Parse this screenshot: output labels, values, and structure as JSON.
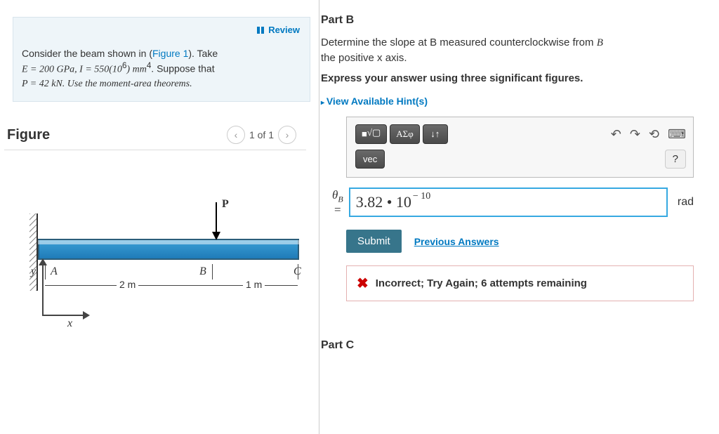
{
  "left": {
    "review_label": "Review",
    "problem_html_prefix": "Consider the beam shown in (",
    "figure_link": "Figure 1",
    "problem_html_suffix": "). Take",
    "problem_line2a": "E = 200 GPa, I = 550(10",
    "problem_line2b": ") mm",
    "problem_line2c": ".  Suppose that",
    "problem_line3": "P = 42 kN.  Use the moment-area theorems.",
    "exp6": "6",
    "exp4": "4",
    "figure_title": "Figure",
    "figure_count": "1 of 1",
    "beam": {
      "P": "P",
      "A": "A",
      "B": "B",
      "C": "C",
      "y": "y",
      "x": "x",
      "d1": "2 m",
      "d2": "1 m"
    }
  },
  "partB": {
    "title": "Part B",
    "desc1": "Determine the slope at B measured counterclockwise from",
    "desc2": "the positive x axis.",
    "instruction": "Express your answer using three significant figures.",
    "hints": "View Available Hint(s)",
    "toolbar": {
      "t1": "■",
      "t2": "√▢",
      "t3": "ΑΣφ",
      "t4": "↓↑",
      "vec": "vec",
      "help": "?"
    },
    "theta": "θ",
    "thetaSub": "B",
    "eq": "=",
    "answer_value": "3.82 • 10",
    "answer_exp": "− 10",
    "unit": "rad",
    "submit": "Submit",
    "prev": "Previous Answers",
    "feedback": "Incorrect; Try Again; 6 attempts remaining"
  },
  "partC": {
    "title": "Part C"
  }
}
